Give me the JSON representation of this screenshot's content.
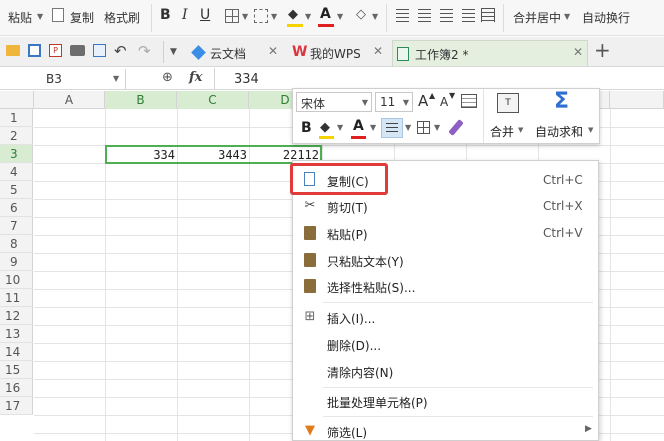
{
  "ribbon": {
    "paste_label": "粘贴",
    "copy_label": "复制",
    "format_painter_label": "格式刷",
    "bold": "B",
    "italic": "I",
    "underline": "U",
    "merge_center_label": "合并居中",
    "wrap_text_label": "自动换行"
  },
  "tabs": [
    {
      "label": "云文档"
    },
    {
      "label": "我的WPS"
    },
    {
      "label": "工作簿2 *"
    }
  ],
  "formula_bar": {
    "name_box": "B3",
    "fx": "fx",
    "value": "334"
  },
  "columns": [
    "A",
    "B",
    "C",
    "D"
  ],
  "rows": [
    "1",
    "2",
    "3",
    "4",
    "5",
    "6",
    "7",
    "8",
    "9",
    "10",
    "11",
    "12",
    "13",
    "14",
    "15",
    "16",
    "17"
  ],
  "cells": {
    "B3": "334",
    "C3": "3443",
    "D3": "22112"
  },
  "mini_toolbar": {
    "font_name": "宋体",
    "font_size": "11",
    "bold": "B",
    "grow_font": "A",
    "shrink_font": "A",
    "merge_label": "合并",
    "autosum_label": "自动求和"
  },
  "context_menu": {
    "items": [
      {
        "label": "复制(C)",
        "shortcut": "Ctrl+C",
        "icon": "copy-icon"
      },
      {
        "label": "剪切(T)",
        "shortcut": "Ctrl+X",
        "icon": "scissors-icon"
      },
      {
        "label": "粘贴(P)",
        "shortcut": "Ctrl+V",
        "icon": "clipboard-icon"
      },
      {
        "label": "只粘贴文本(Y)",
        "shortcut": "",
        "icon": "paste-text-icon"
      },
      {
        "label": "选择性粘贴(S)...",
        "shortcut": "",
        "icon": "paste-special-icon"
      },
      {
        "label": "插入(I)...",
        "shortcut": "",
        "icon": "insert-icon"
      },
      {
        "label": "删除(D)...",
        "shortcut": "",
        "icon": ""
      },
      {
        "label": "清除内容(N)",
        "shortcut": "",
        "icon": ""
      },
      {
        "label": "批量处理单元格(P)",
        "shortcut": "",
        "icon": ""
      },
      {
        "label": "筛选(L)",
        "shortcut": "",
        "icon": "filter-icon"
      }
    ]
  },
  "colors": {
    "selection_green": "#4caf50",
    "highlight_red": "#e03a3a",
    "wps_red": "#d9363e"
  }
}
